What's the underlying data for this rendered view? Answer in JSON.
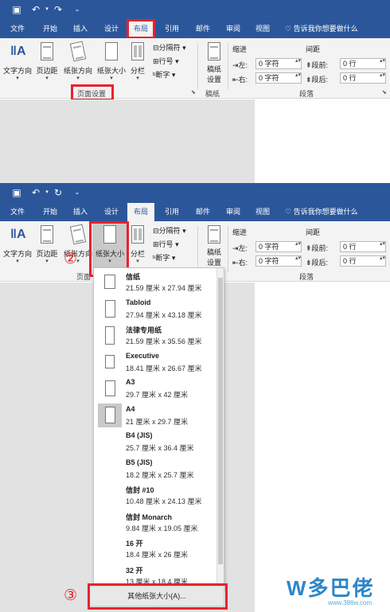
{
  "top_panel": {
    "tabs": [
      "文件",
      "开始",
      "插入",
      "设计",
      "布局",
      "引用",
      "邮件",
      "审阅",
      "视图"
    ],
    "tell_me": "告诉我你想要做什么",
    "ribbon": {
      "text_direction": "文字方向",
      "margins": "页边距",
      "orientation": "纸张方向",
      "size": "纸张大小",
      "columns": "分栏",
      "breaks": "分隔符",
      "line_numbers": "行号",
      "hyphenation": "断字",
      "draft_paper": [
        "稿纸",
        "设置"
      ],
      "draft_group": "稿纸",
      "page_setup_group": "页面设置",
      "indent_header": "缩进",
      "spacing_header": "间距",
      "left_label": "左:",
      "right_label": "右:",
      "before_label": "段前:",
      "after_label": "段后:",
      "indent_value": "0 字符",
      "spacing_value": "0 行",
      "paragraph_group": "段落"
    }
  },
  "bottom_panel": {
    "annotation_2": "②",
    "annotation_3": "③",
    "page_setup_group_partial": "页面",
    "menu_items": [
      {
        "name": "信纸",
        "dims": "21.59 厘米 x 27.94 厘米"
      },
      {
        "name": "Tabloid",
        "dims": "27.94 厘米 x 43.18 厘米"
      },
      {
        "name": "法律专用纸",
        "dims": "21.59 厘米 x 35.56 厘米"
      },
      {
        "name": "Executive",
        "dims": "18.41 厘米 x 26.67 厘米"
      },
      {
        "name": "A3",
        "dims": "29.7 厘米 x 42 厘米"
      },
      {
        "name": "A4",
        "dims": "21 厘米 x 29.7 厘米"
      },
      {
        "name": "B4 (JIS)",
        "dims": "25.7 厘米 x 36.4 厘米"
      },
      {
        "name": "B5 (JIS)",
        "dims": "18.2 厘米 x 25.7 厘米"
      },
      {
        "name": "信封 #10",
        "dims": "10.48 厘米 x 24.13 厘米"
      },
      {
        "name": "信封 Monarch",
        "dims": "9.84 厘米 x 19.05 厘米"
      },
      {
        "name": "16 开",
        "dims": "18.4 厘米 x 26 厘米"
      },
      {
        "name": "32 开",
        "dims": "13 厘米 x 18.4 厘米"
      }
    ],
    "more_sizes": "其他纸张大小(A)...",
    "watermark": "W多巴佬",
    "watermark_url": "www.386w.com"
  },
  "colors": {
    "word_blue": "#2b579a",
    "annotation_red": "#e8222d",
    "selected": "#c9c9c9"
  }
}
